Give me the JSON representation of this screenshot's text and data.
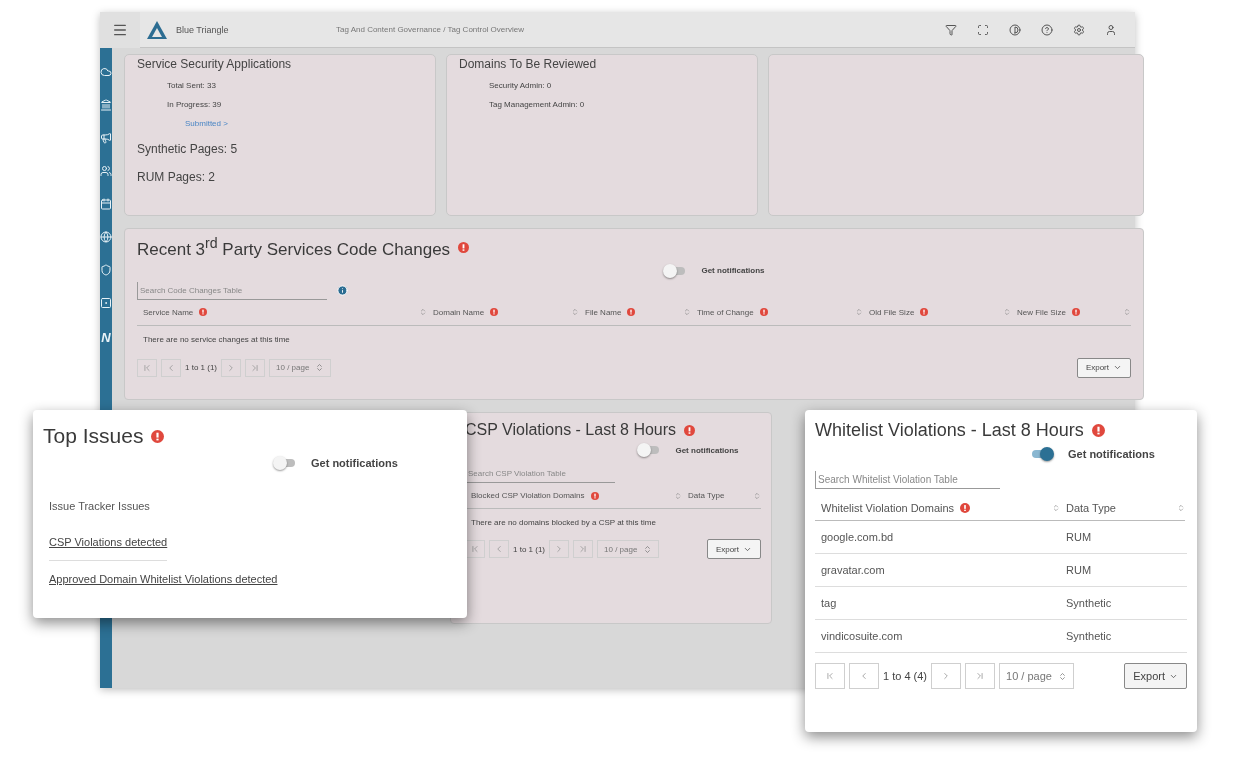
{
  "topbar": {
    "org": "Blue Triangle",
    "breadcrumb": "Tag And Content Governance / Tag Control Overview"
  },
  "sidebar": {
    "footer_mark": "N"
  },
  "summary_cards": [
    {
      "title": "Service Security Applications",
      "lines": [
        {
          "kind": "stat",
          "text": "Total Sent: 33"
        },
        {
          "kind": "stat",
          "text": "In Progress: 39"
        },
        {
          "kind": "link",
          "text": "Submitted >"
        },
        {
          "kind": "large",
          "text": "Synthetic Pages: 5"
        },
        {
          "kind": "large",
          "text": "RUM Pages: 2"
        }
      ]
    },
    {
      "title": "Domains To Be Reviewed",
      "lines": [
        {
          "kind": "stat",
          "text": "Security Admin: 0"
        },
        {
          "kind": "stat",
          "text": "Tag Management Admin: 0"
        }
      ]
    }
  ],
  "code_changes": {
    "title": "Recent 3$^{rd}$ Party Services Code Changes",
    "notifications": {
      "label": "Get notifications",
      "on": false
    },
    "search": {
      "placeholder": "Search Code Changes Table"
    },
    "columns": [
      {
        "label": "Service Name",
        "info": true
      },
      {
        "label": "Domain Name",
        "info": true
      },
      {
        "label": "File Name",
        "info": true
      },
      {
        "label": "Time of Change",
        "info": true
      },
      {
        "label": "Old File Size",
        "info": true
      },
      {
        "label": "New File Size",
        "info": true
      }
    ],
    "empty_message": "There are no service changes at this time",
    "pagination": {
      "range": "1 to 1 (1)",
      "page_size": "10 / page"
    },
    "export": "Export"
  },
  "csp_violations": {
    "title": "CSP Violations - Last 8 Hours",
    "notifications": {
      "label": "Get notifications",
      "on": false
    },
    "search": {
      "placeholder": "Search CSP Violation Table"
    },
    "columns": [
      {
        "label": "Blocked CSP Violation Domains",
        "info": true
      },
      {
        "label": "Data Type",
        "info": false
      }
    ],
    "empty_message": "There are no domains blocked by a CSP at this time",
    "pagination": {
      "range": "1 to 1 (1)",
      "page_size": "10 / page"
    },
    "export": "Export"
  },
  "top_issues": {
    "title": "Top Issues",
    "notifications": {
      "label": "Get notifications",
      "on": false
    },
    "heading": "Issue Tracker Issues",
    "links": [
      "CSP Violations detected",
      "Approved Domain Whitelist Violations detected"
    ]
  },
  "whitelist_violations": {
    "title": "Whitelist Violations - Last 8 Hours",
    "notifications": {
      "label": "Get notifications",
      "on": true
    },
    "search": {
      "placeholder": "Search Whitelist Violation Table"
    },
    "columns": [
      {
        "label": "Whitelist Violation Domains",
        "info": true
      },
      {
        "label": "Data Type",
        "info": false
      }
    ],
    "rows": [
      [
        "google.com.bd",
        "RUM"
      ],
      [
        "gravatar.com",
        "RUM"
      ],
      [
        "tag",
        "Synthetic"
      ],
      [
        "vindicosuite.com",
        "Synthetic"
      ]
    ],
    "pagination": {
      "range": "1 to 4 (4)",
      "page_size": "10 / page"
    },
    "export": "Export"
  }
}
